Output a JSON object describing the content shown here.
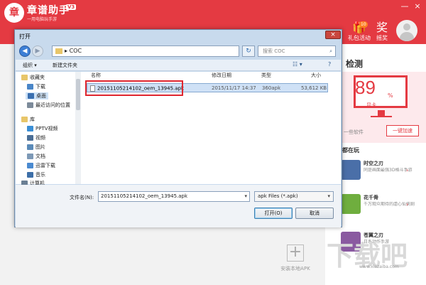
{
  "app": {
    "logo_char": "章",
    "title": "章谱助手",
    "version": "V3",
    "slogan": "一用电脑玩手游",
    "window_controls": [
      "—",
      "×"
    ],
    "gift_label": "礼包活动",
    "gift_badge": "10",
    "award_label": "摇奖",
    "gift_icon": "gift-icon",
    "award_icon": "award-icon"
  },
  "right_panel": {
    "detect_title": "检测",
    "score": "89",
    "score_unit": "%",
    "rank_label": "显卡",
    "software_text": "一些软件",
    "speed_button": "一键加速",
    "playing_title": "都在玩",
    "games": [
      {
        "name": "时空之刃",
        "desc": "同是画面最强3D格斗手游",
        "color": "#4a6fa8"
      },
      {
        "name": "花千骨",
        "desc": "千万观众期待的虐心仙侠剧",
        "color": "#6fae3e"
      },
      {
        "name": "苍翼之刃",
        "desc": "日系动作手游",
        "color": "#8a5aa0"
      }
    ],
    "add_apk_label": "安装本地APK"
  },
  "watermark": {
    "text": "下载吧",
    "url": "www.xiazaiba.com"
  },
  "dialog": {
    "title": "打开",
    "close": "×",
    "address": "COC",
    "search_placeholder": "搜索 COC",
    "toolbar": {
      "organize": "组织 ▾",
      "new_folder": "新建文件夹",
      "view_icon": "☷ ▾",
      "help": "?"
    },
    "nav_items": [
      {
        "label": "收藏夹",
        "color": "#e8c66a",
        "selected": false,
        "indent": 0
      },
      {
        "label": "下载",
        "color": "#4a86c8",
        "selected": false,
        "indent": 8
      },
      {
        "label": "桌面",
        "color": "#3a6fb0",
        "selected": true,
        "indent": 8
      },
      {
        "label": "最近访问的位置",
        "color": "#7d8b9a",
        "selected": false,
        "indent": 8
      },
      {
        "label": "库",
        "color": "#e8c66a",
        "selected": false,
        "indent": 0
      },
      {
        "label": "PPTV视频",
        "color": "#3a8fd6",
        "selected": false,
        "indent": 8
      },
      {
        "label": "视频",
        "color": "#4a6e96",
        "selected": false,
        "indent": 8
      },
      {
        "label": "图片",
        "color": "#5a8ab8",
        "selected": false,
        "indent": 8
      },
      {
        "label": "文档",
        "color": "#7d99b6",
        "selected": false,
        "indent": 8
      },
      {
        "label": "迅雷下载",
        "color": "#4a8ad0",
        "selected": false,
        "indent": 8
      },
      {
        "label": "音乐",
        "color": "#3d6fa8",
        "selected": false,
        "indent": 8
      },
      {
        "label": "计算机",
        "color": "#6a7f94",
        "selected": false,
        "indent": 0
      }
    ],
    "columns": {
      "name": "名称",
      "date": "修改日期",
      "type": "类型",
      "size": "大小"
    },
    "files": [
      {
        "name": "20151105214102_oem_13945.apk",
        "date": "2015/11/17 14:37",
        "type": "360apk",
        "size": "53,612 KB"
      }
    ],
    "filename_label": "文件名(N):",
    "filename_value": "20151105214102_oem_13945.apk",
    "filetype_value": "apk Files (*.apk)",
    "open_button": "打开(O)",
    "cancel_button": "取消"
  }
}
